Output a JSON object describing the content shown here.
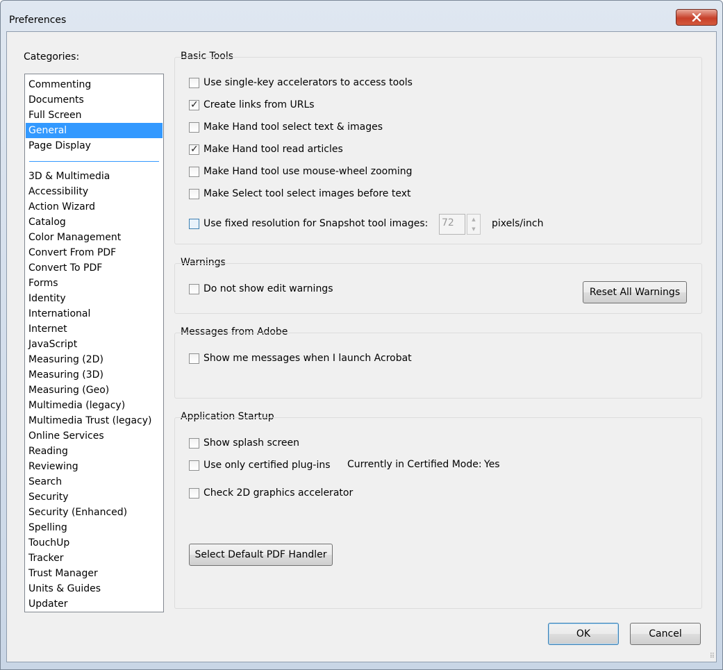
{
  "window": {
    "title": "Preferences"
  },
  "categories": {
    "label": "Categories:",
    "top_items": [
      "Commenting",
      "Documents",
      "Full Screen",
      "General",
      "Page Display"
    ],
    "selected": "General",
    "items": [
      "3D & Multimedia",
      "Accessibility",
      "Action Wizard",
      "Catalog",
      "Color Management",
      "Convert From PDF",
      "Convert To PDF",
      "Forms",
      "Identity",
      "International",
      "Internet",
      "JavaScript",
      "Measuring (2D)",
      "Measuring (3D)",
      "Measuring (Geo)",
      "Multimedia (legacy)",
      "Multimedia Trust (legacy)",
      "Online Services",
      "Reading",
      "Reviewing",
      "Search",
      "Security",
      "Security (Enhanced)",
      "Spelling",
      "TouchUp",
      "Tracker",
      "Trust Manager",
      "Units & Guides",
      "Updater"
    ]
  },
  "basic_tools": {
    "title": "Basic Tools",
    "options": [
      {
        "label": "Use single-key accelerators to access tools",
        "checked": false
      },
      {
        "label": "Create links from URLs",
        "checked": true
      },
      {
        "label": "Make Hand tool select text & images",
        "checked": false
      },
      {
        "label": "Make Hand tool read articles",
        "checked": true
      },
      {
        "label": "Make Hand tool use mouse-wheel zooming",
        "checked": false
      },
      {
        "label": "Make Select tool select images before text",
        "checked": false
      }
    ],
    "snapshot": {
      "label": "Use fixed resolution for Snapshot tool images:",
      "checked": false,
      "value": "72",
      "unit": "pixels/inch"
    }
  },
  "warnings": {
    "title": "Warnings",
    "option": {
      "label": "Do not show edit warnings",
      "checked": false
    },
    "reset_label": "Reset All Warnings"
  },
  "messages": {
    "title": "Messages from Adobe",
    "option": {
      "label": "Show me messages when I launch Acrobat",
      "checked": false
    }
  },
  "startup": {
    "title": "Application Startup",
    "splash": {
      "label": "Show splash screen",
      "checked": false
    },
    "certified": {
      "label": "Use only certified plug-ins",
      "checked": false
    },
    "mode_label": "Currently in Certified Mode:",
    "mode_value": "Yes",
    "graphics": {
      "label": "Check 2D graphics accelerator",
      "checked": false
    },
    "pdf_handler_label": "Select Default PDF Handler"
  },
  "footer": {
    "ok_label": "OK",
    "cancel_label": "Cancel"
  },
  "icons": {
    "close": "close-icon",
    "spin_up": "spin-up-icon",
    "spin_down": "spin-down-icon",
    "grip": "resize-grip-icon"
  },
  "colors": {
    "selection": "#3399ff",
    "close_button": "#c7402a"
  }
}
